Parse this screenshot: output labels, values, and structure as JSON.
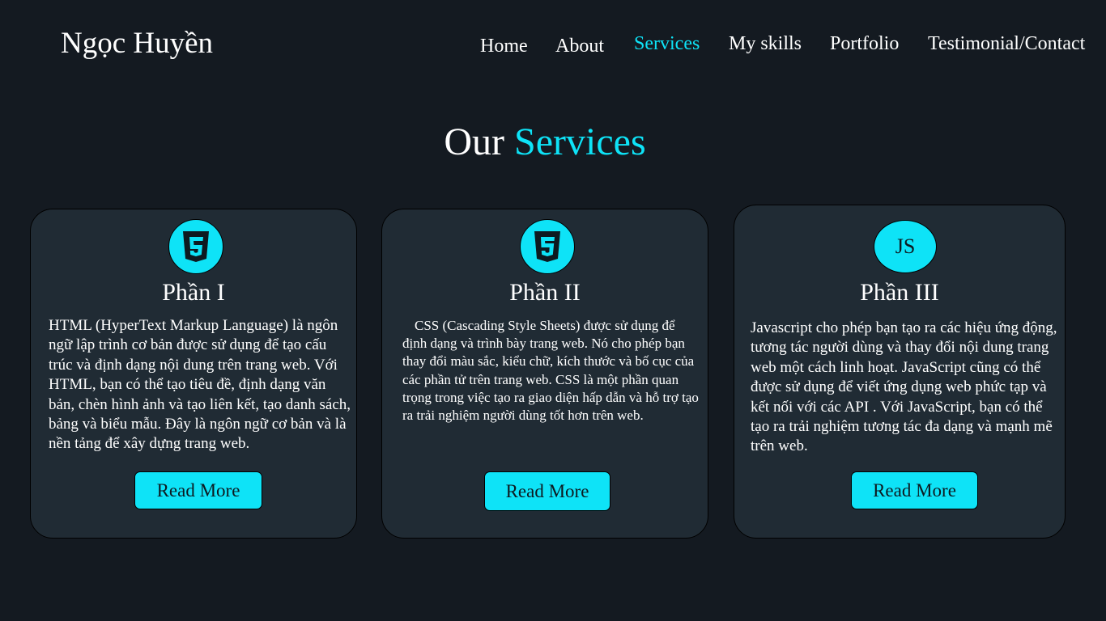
{
  "header": {
    "logo": "Ngọc Huyền",
    "nav": [
      {
        "label": "Home",
        "active": false
      },
      {
        "label": "About",
        "active": false
      },
      {
        "label": "Services",
        "active": true
      },
      {
        "label": "My skills",
        "active": false
      },
      {
        "label": "Portfolio",
        "active": false
      },
      {
        "label": "Testimonial/Contact",
        "active": false
      }
    ]
  },
  "section": {
    "title_plain": "Our",
    "title_accent": "Services"
  },
  "cards": [
    {
      "icon": "html5-icon",
      "title": "Phần I",
      "text": "HTML (HyperText Markup Language) là ngôn ngữ lập trình cơ bản được sử dụng để tạo cấu trúc và định dạng nội dung trên trang web. Với HTML, bạn có thể tạo tiêu đề, định dạng văn bản, chèn hình ảnh và tạo liên kết, tạo danh sách, bảng và biểu mẫu. Đây là ngôn ngữ cơ bản và là nền tảng để xây dựng trang web.",
      "button": "Read More"
    },
    {
      "icon": "css3-icon",
      "title": "Phần II",
      "text": "CSS (Cascading Style Sheets) được sử dụng để định dạng và trình bày trang web. Nó cho phép bạn thay đổi màu sắc, kiểu chữ, kích thước và bố cục của các phần tử trên trang web. CSS là một phần quan trọng trong việc tạo ra giao diện hấp dẫn và hỗ trợ tạo ra trải nghiệm người dùng tốt hơn trên web.",
      "button": "Read More"
    },
    {
      "icon": "js-icon",
      "icon_text": "JS",
      "title": "Phần III",
      "text": "Javascript cho phép bạn tạo ra các hiệu ứng động, tương tác người dùng và thay đổi nội dung trang web một cách linh hoạt. JavaScript cũng có thể được sử dụng để viết ứng dụng web phức tạp và kết nối với các API . Với JavaScript, bạn có thể tạo ra trải nghiệm tương tác đa dạng và mạnh mẽ trên web.",
      "button": "Read More"
    }
  ],
  "colors": {
    "background": "#141a21",
    "card": "#202b34",
    "accent": "#0ee3f7"
  }
}
